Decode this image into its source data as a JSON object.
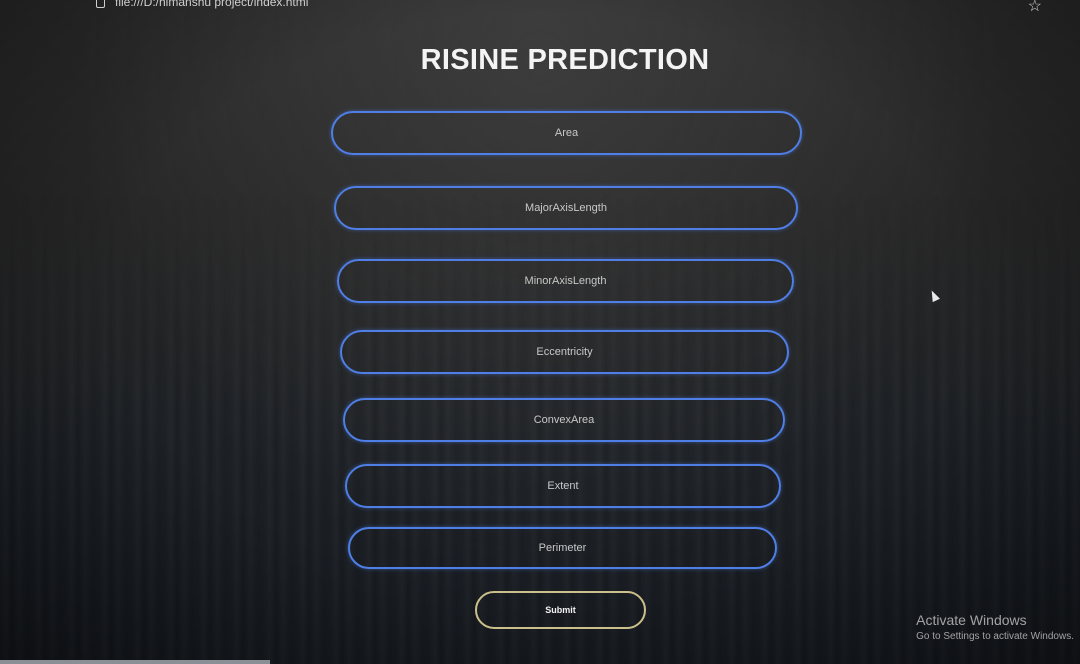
{
  "browser": {
    "url": "file:///D:/himanshu project/index.html"
  },
  "page": {
    "title": "RISINE PREDICTION"
  },
  "form": {
    "fields": [
      {
        "placeholder": "Area"
      },
      {
        "placeholder": "MajorAxisLength"
      },
      {
        "placeholder": "MinorAxisLength"
      },
      {
        "placeholder": "Eccentricity"
      },
      {
        "placeholder": "ConvexArea"
      },
      {
        "placeholder": "Extent"
      },
      {
        "placeholder": "Perimeter"
      }
    ],
    "submit_label": "Submit"
  },
  "watermark": {
    "line1": "Activate Windows",
    "line2": "Go to Settings to activate Windows."
  },
  "colors": {
    "field_border": "#4f7fe6",
    "submit_border": "#cbbf8c",
    "title": "#f4f4f4"
  }
}
